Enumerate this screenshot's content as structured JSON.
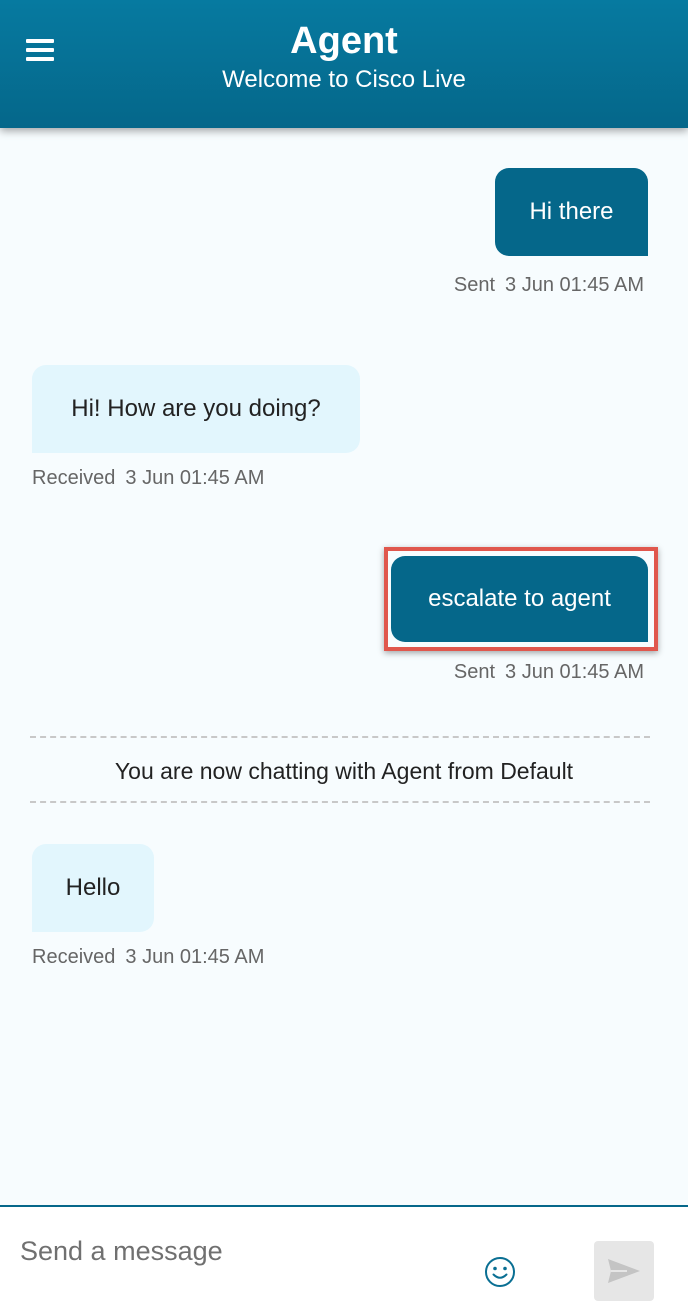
{
  "header": {
    "title": "Agent",
    "subtitle": "Welcome to Cisco Live",
    "menu_icon": "hamburger-menu-icon"
  },
  "messages": [
    {
      "direction": "sent",
      "text": "Hi there",
      "status": "Sent",
      "time": "3 Jun 01:45 AM"
    },
    {
      "direction": "received",
      "text": "Hi! How are you doing?",
      "status": "Received",
      "time": "3 Jun 01:45 AM"
    },
    {
      "direction": "sent",
      "text": "escalate to agent",
      "status": "Sent",
      "time": "3 Jun 01:45 AM",
      "highlighted": true
    },
    {
      "direction": "received",
      "text": "Hello",
      "status": "Received",
      "time": "3 Jun 01:45 AM"
    }
  ],
  "system_message": "You are now chatting with Agent from Default",
  "composer": {
    "placeholder": "Send a message",
    "emoji_icon": "smiley-icon",
    "send_icon": "send-arrow-icon"
  },
  "colors": {
    "brand": "#05678A",
    "received_bubble": "#E2F6FD",
    "highlight": "#E0574D"
  }
}
